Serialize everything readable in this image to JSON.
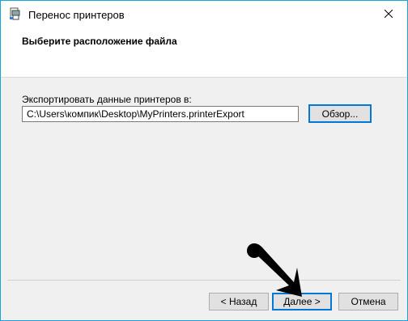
{
  "window": {
    "title": "Перенос принтеров",
    "icon": "printer-migration-icon",
    "close_icon": "close-icon"
  },
  "header": {
    "title": "Выберите расположение файла"
  },
  "export": {
    "label": "Экспортировать данные принтеров в:",
    "path_value": "C:\\Users\\компик\\Desktop\\MyPrinters.printerExport",
    "browse_label": "Обзор..."
  },
  "footer": {
    "back_label": "< Назад",
    "next_label": "Далее >",
    "cancel_label": "Отмена"
  },
  "colors": {
    "accent": "#0078d7",
    "window_border": "#1aa3d6",
    "dialog_bg": "#f0f0f0"
  }
}
